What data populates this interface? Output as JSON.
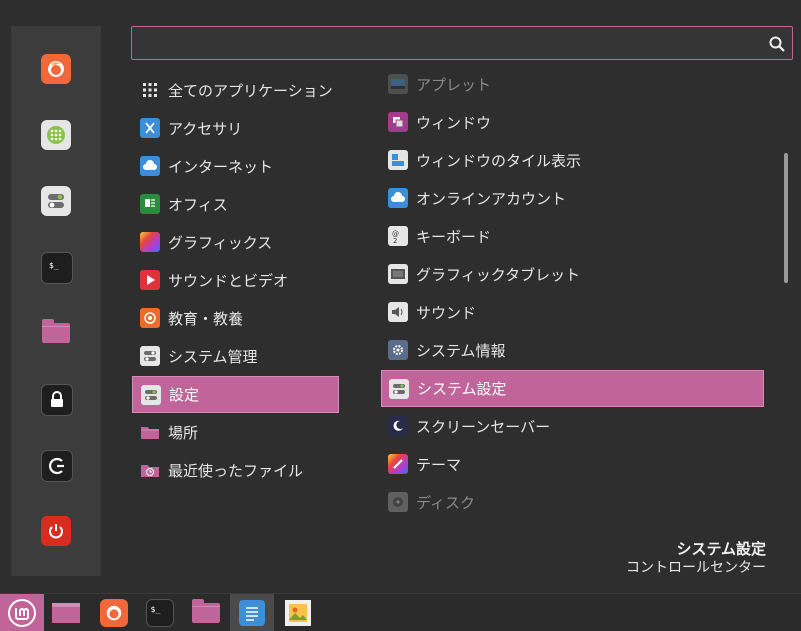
{
  "search": {
    "value": "",
    "placeholder": ""
  },
  "favorites": [
    {
      "name": "firefox-icon"
    },
    {
      "name": "software-manager-icon"
    },
    {
      "name": "system-settings-icon"
    },
    {
      "name": "terminal-icon"
    },
    {
      "name": "files-icon"
    },
    {
      "name": "lock-icon"
    },
    {
      "name": "logout-icon"
    },
    {
      "name": "power-icon"
    }
  ],
  "categories": [
    {
      "label": "全てのアプリケーション",
      "icon": "grid-icon"
    },
    {
      "label": "アクセサリ",
      "icon": "accessories-icon"
    },
    {
      "label": "インターネット",
      "icon": "internet-icon"
    },
    {
      "label": "オフィス",
      "icon": "office-icon"
    },
    {
      "label": "グラフィックス",
      "icon": "graphics-icon"
    },
    {
      "label": "サウンドとビデオ",
      "icon": "sound-video-icon"
    },
    {
      "label": "教育・教養",
      "icon": "education-icon"
    },
    {
      "label": "システム管理",
      "icon": "administration-icon"
    },
    {
      "label": "設定",
      "icon": "preferences-icon",
      "selected": true
    },
    {
      "label": "場所",
      "icon": "places-folder-icon"
    },
    {
      "label": "最近使ったファイル",
      "icon": "recent-files-icon"
    }
  ],
  "apps": [
    {
      "label": "アプレット",
      "icon": "applets-icon",
      "dim": true
    },
    {
      "label": "ウィンドウ",
      "icon": "windows-icon"
    },
    {
      "label": "ウィンドウのタイル表示",
      "icon": "window-tiling-icon"
    },
    {
      "label": "オンラインアカウント",
      "icon": "online-accounts-icon"
    },
    {
      "label": "キーボード",
      "icon": "keyboard-icon"
    },
    {
      "label": "グラフィックタブレット",
      "icon": "tablet-icon"
    },
    {
      "label": "サウンド",
      "icon": "sound-icon"
    },
    {
      "label": "システム情報",
      "icon": "system-info-icon"
    },
    {
      "label": "システム設定",
      "icon": "system-settings-icon",
      "selected": true
    },
    {
      "label": "スクリーンセーバー",
      "icon": "screensaver-icon"
    },
    {
      "label": "テーマ",
      "icon": "themes-icon"
    },
    {
      "label": "ディスク",
      "icon": "disks-icon",
      "dim": true
    }
  ],
  "description": {
    "title": "システム設定",
    "subtitle": "コントロールセンター"
  },
  "taskbar": [
    {
      "name": "menu-button"
    },
    {
      "name": "show-desktop-icon"
    },
    {
      "name": "firefox-icon"
    },
    {
      "name": "terminal-icon"
    },
    {
      "name": "files-icon"
    },
    {
      "name": "text-editor-icon"
    },
    {
      "name": "image-viewer-icon"
    }
  ],
  "colors": {
    "accent": "#c0649a",
    "background": "#2e2e2e",
    "sidebar": "#3c3c3c"
  }
}
